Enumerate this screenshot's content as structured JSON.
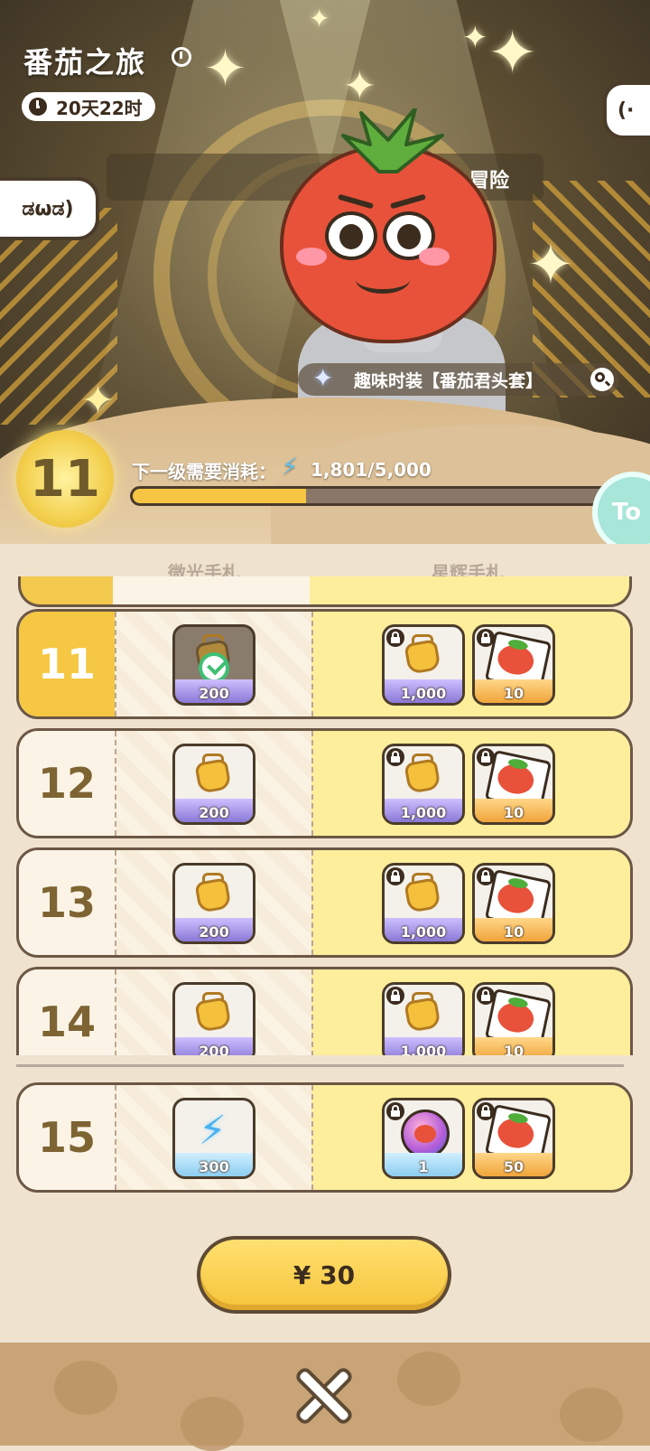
{
  "header": {
    "title": "番茄之旅",
    "timer": "20天22时",
    "bubble_left": "ಡωಡ)",
    "bubble_right": "(·",
    "banner": "冒险"
  },
  "costume": {
    "label": "趣味时装【番茄君头套】"
  },
  "progress": {
    "level": "11",
    "next_label": "下一级需要消耗：",
    "value_text": "1,801/5,000",
    "fraction": 0.36
  },
  "side_tab": "To",
  "columns": {
    "free": "微光手札",
    "premium": "星辉手札"
  },
  "rows": [
    {
      "level": "11",
      "free_qty": "200",
      "prem1_qty": "1,000",
      "prem2_qty": "10"
    },
    {
      "level": "12",
      "free_qty": "200",
      "prem1_qty": "1,000",
      "prem2_qty": "10"
    },
    {
      "level": "13",
      "free_qty": "200",
      "prem1_qty": "1,000",
      "prem2_qty": "10"
    },
    {
      "level": "14",
      "free_qty": "200",
      "prem1_qty": "1,000",
      "prem2_qty": "10"
    },
    {
      "level": "15",
      "free_qty": "300",
      "prem1_qty": "1",
      "prem2_qty": "50"
    }
  ],
  "buy_button": "¥ 30",
  "colors": {
    "accent": "#f6c544",
    "border": "#6b5744",
    "premium_bg": "#fcee9a"
  }
}
